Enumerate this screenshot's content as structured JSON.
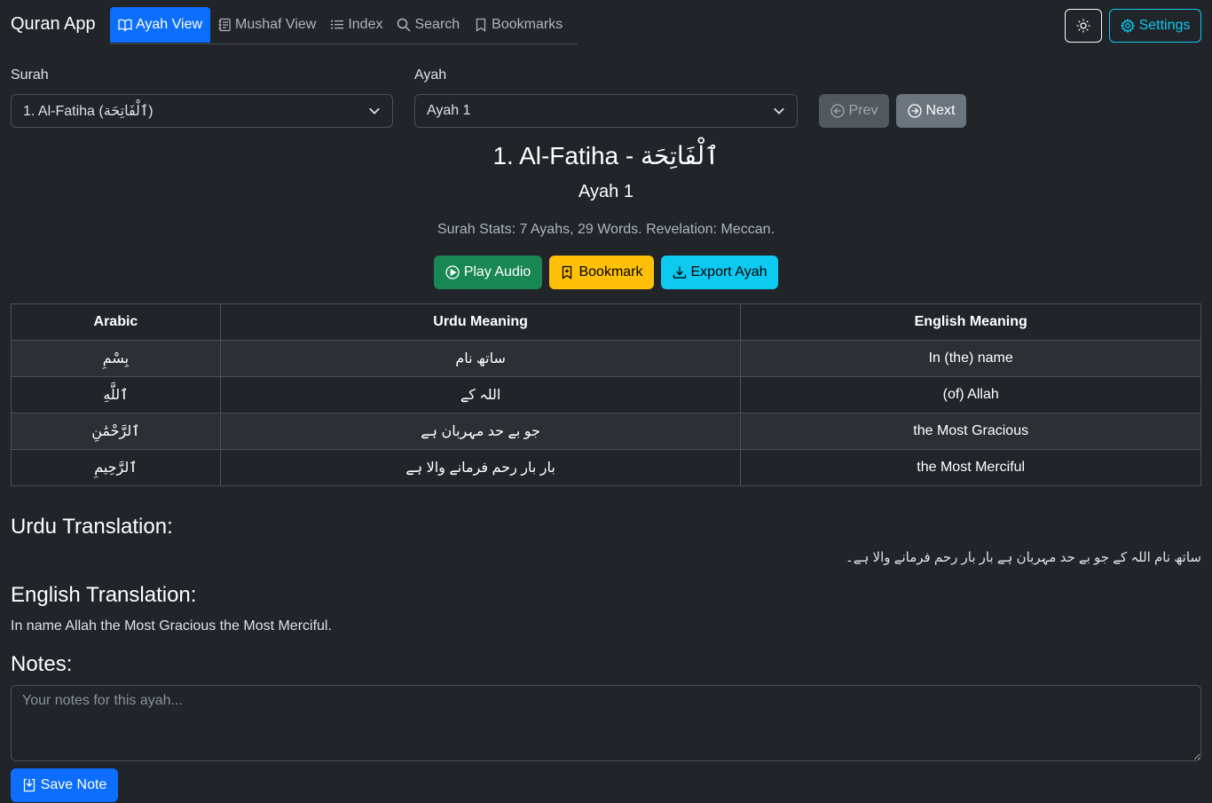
{
  "app": {
    "brand": "Quran App"
  },
  "nav": {
    "tabs": [
      {
        "label": "Ayah View",
        "icon": "book-icon",
        "active": true
      },
      {
        "label": "Mushaf View",
        "icon": "journal-icon",
        "active": false
      },
      {
        "label": "Index",
        "icon": "list-icon",
        "active": false
      },
      {
        "label": "Search",
        "icon": "search-icon",
        "active": false
      },
      {
        "label": "Bookmarks",
        "icon": "bookmark-icon",
        "active": false
      }
    ],
    "settings_label": "Settings"
  },
  "selectors": {
    "surah_label": "Surah",
    "surah_value": "1. Al-Fatiha (ٱلْفَاتِحَة)",
    "ayah_label": "Ayah",
    "ayah_value": "Ayah 1",
    "prev_label": "Prev",
    "next_label": "Next"
  },
  "header": {
    "surah_title": "1. Al-Fatiha - ٱلْفَاتِحَة",
    "ayah_title": "Ayah 1",
    "stats": "Surah Stats: 7 Ayahs, 29 Words. Revelation: Meccan."
  },
  "actions": {
    "play_label": "Play Audio",
    "bookmark_label": "Bookmark",
    "export_label": "Export Ayah"
  },
  "word_table": {
    "headers": [
      "Arabic",
      "Urdu Meaning",
      "English Meaning"
    ],
    "rows": [
      [
        "بِسْمِ",
        "ساتھ نام",
        "In (the) name"
      ],
      [
        "ٱللَّهِ",
        "اللہ کے",
        "(of) Allah"
      ],
      [
        "ٱلرَّحْمَٰنِ",
        "جو بے حد مہربان ہے",
        "the Most Gracious"
      ],
      [
        "ٱلرَّحِيمِ",
        "بار بار رحم فرمانے والا ہے",
        "the Most Merciful"
      ]
    ]
  },
  "translations": {
    "urdu_heading": "Urdu Translation:",
    "urdu_text": "ساتھ نام اللہ کے جو بے حد مہربان ہے بار بار رحم فرمانے والا ہے۔",
    "english_heading": "English Translation:",
    "english_text": "In name Allah the Most Gracious the Most Merciful."
  },
  "notes": {
    "heading": "Notes:",
    "placeholder": "Your notes for this ayah...",
    "save_label": "Save Note"
  },
  "colors": {
    "background": "#212529",
    "primary": "#0d6efd",
    "success": "#198754",
    "warning": "#ffc107",
    "info": "#0dcaf0",
    "secondary": "#6c757d"
  }
}
